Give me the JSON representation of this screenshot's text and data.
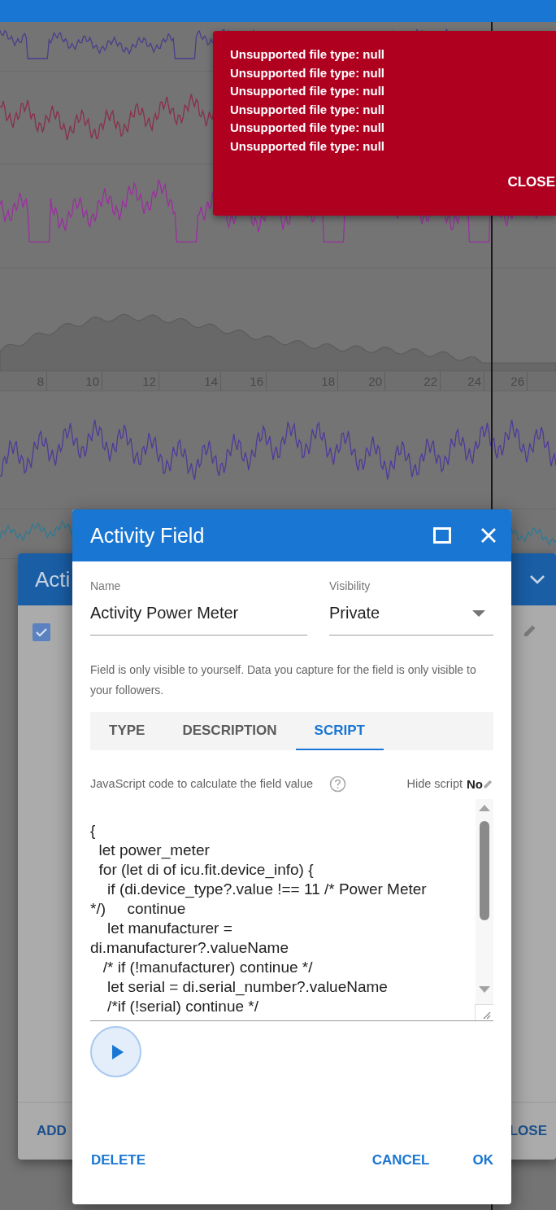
{
  "chart_axis": {
    "ticks": [
      "8",
      "10",
      "12",
      "14",
      "16",
      "18",
      "20",
      "22",
      "24",
      "26"
    ]
  },
  "toast": {
    "messages": [
      "Unsupported file type: null",
      "Unsupported file type: null",
      "Unsupported file type: null",
      "Unsupported file type: null",
      "Unsupported file type: null",
      "Unsupported file type: null"
    ],
    "action": "CLOSE"
  },
  "background_dialog": {
    "title": "Acti",
    "checkbox_checked": true,
    "buttons": [
      "ADD",
      "LOSE"
    ]
  },
  "dialog": {
    "title": "Activity Field",
    "fields": [
      {
        "kind": "text",
        "label": "Name",
        "value": "Activity Power Meter"
      },
      {
        "kind": "select",
        "label": "Visibility",
        "value": "Private"
      }
    ],
    "helper": "Field is only visible to yourself. Data you capture for the field is only visible to your followers.",
    "tabs": [
      {
        "label": "TYPE",
        "selected": false
      },
      {
        "label": "DESCRIPTION",
        "selected": false
      },
      {
        "label": "SCRIPT",
        "selected": true
      }
    ],
    "script_label": "JavaScript code to calculate the field value",
    "hide_script": {
      "label": "Hide script",
      "value": "No"
    },
    "code_lines": [
      "{",
      "  let power_meter",
      "  for (let di of icu.fit.device_info) {",
      "    if (di.device_type?.value !== 11 /* Power Meter",
      "*/)     continue",
      "    let manufacturer =",
      "di.manufacturer?.valueName",
      "   /* if (!manufacturer) continue */",
      "    let serial = di.serial_number?.valueName",
      "    /*if (!serial) continue */"
    ],
    "buttons": [
      {
        "kind": "left",
        "label": "DELETE"
      },
      {
        "kind": "right",
        "label": "CANCEL"
      },
      {
        "kind": "right",
        "label": "OK"
      }
    ]
  }
}
